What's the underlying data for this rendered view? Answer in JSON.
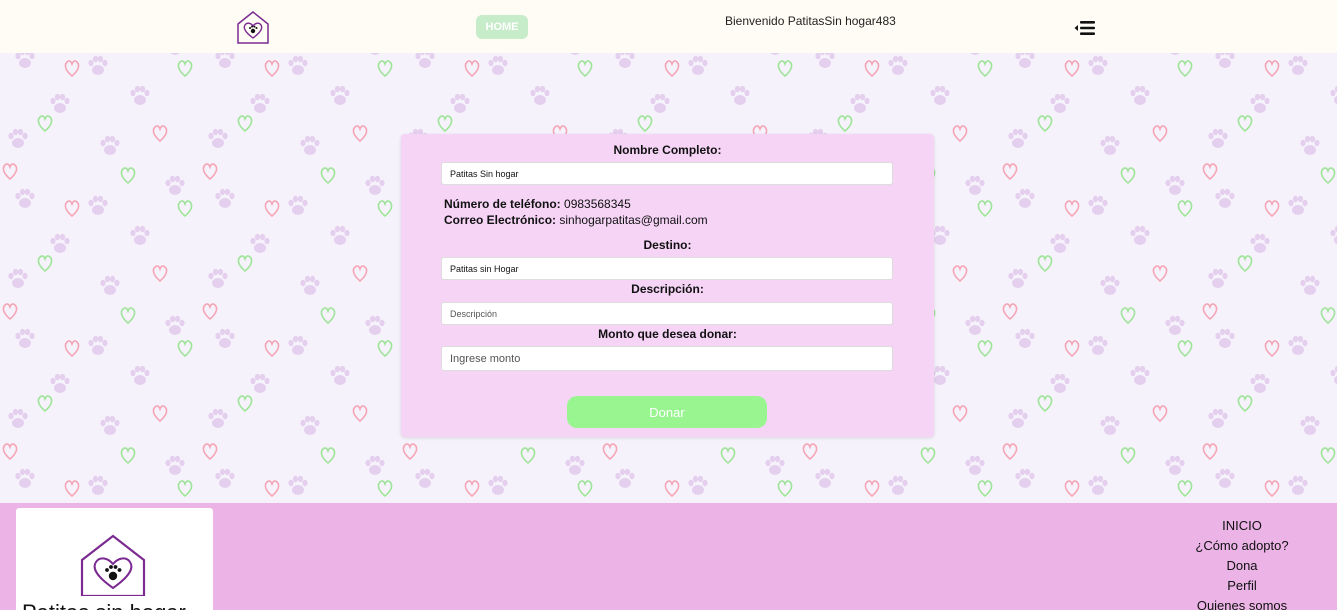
{
  "header": {
    "logo_icon": "paw-heart-house-icon",
    "home_label": "HOME",
    "welcome_text": "Bienvenido PatitasSin hogar483",
    "menu_icon": "menu-icon"
  },
  "form": {
    "name_label": "Nombre Completo:",
    "name_value": "Patitas Sin hogar",
    "phone_label": "Número de teléfono:",
    "phone_value": "0983568345",
    "email_label": "Correo Electrónico:",
    "email_value": "sinhogarpatitas@gmail.com",
    "destination_label": "Destino:",
    "destination_value": "Patitas sin Hogar",
    "description_label": "Descripción:",
    "description_placeholder": "Descripción",
    "amount_label": "Monto que desea donar:",
    "amount_placeholder": "Ingrese monto",
    "submit_label": "Donar"
  },
  "footer": {
    "logo_text": "Patitas sin hogar",
    "links": [
      "INICIO",
      "¿Cómo adopto?",
      "Dona",
      "Perfil",
      "Quienes somos"
    ]
  },
  "colors": {
    "header_bg": "#fffcf5",
    "home_btn": "#c6ecca",
    "card_bg": "#f5d4f5",
    "donate_btn": "#98f590",
    "footer_bg": "#ebb3e6",
    "logo_purple": "#7a2a90"
  }
}
